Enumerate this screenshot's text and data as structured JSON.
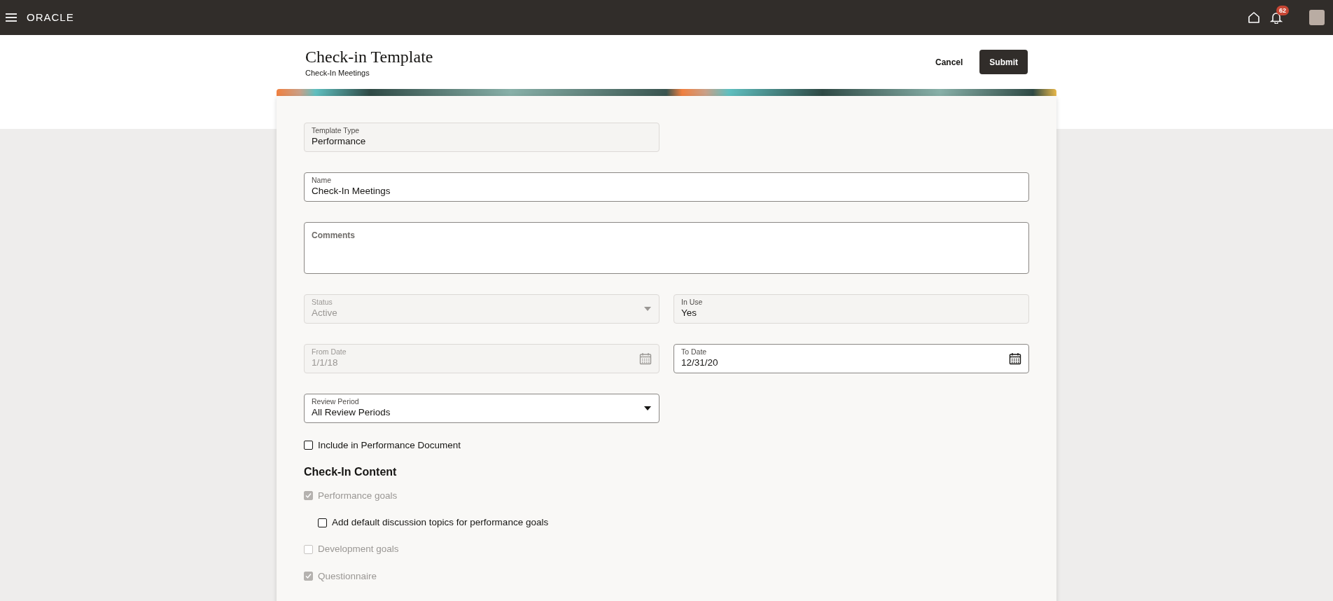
{
  "header": {
    "logo": "ORACLE",
    "notifications_count": "62"
  },
  "page": {
    "title": "Check-in Template",
    "subtitle": "Check-In Meetings",
    "actions": [
      {
        "label": "Cancel",
        "kind": "text"
      },
      {
        "label": "Submit",
        "kind": "primary"
      }
    ]
  },
  "form": {
    "rows": [
      [
        {
          "label": "Template Type",
          "value": "Performance",
          "kind": "readonly",
          "disabled": false
        }
      ],
      [
        {
          "label": "Name",
          "value": "Check-In Meetings",
          "kind": "text",
          "disabled": false,
          "wide": true
        }
      ],
      [
        {
          "label": "Comments",
          "kind": "textarea",
          "disabled": false,
          "wide": true
        }
      ],
      [
        {
          "label": "Status",
          "value": "Active",
          "kind": "select",
          "disabled": true
        },
        {
          "label": "In Use",
          "value": "Yes",
          "kind": "readonly",
          "disabled": false
        }
      ],
      [
        {
          "label": "From Date",
          "value": "1/1/18",
          "kind": "date",
          "disabled": true
        },
        {
          "label": "To Date",
          "value": "12/31/20",
          "kind": "date",
          "disabled": false
        }
      ],
      [
        {
          "label": "Review Period",
          "value": "All Review Periods",
          "kind": "select",
          "disabled": false
        }
      ]
    ],
    "include_checkbox": {
      "label": "Include in Performance Document",
      "checked": false,
      "disabled": false
    },
    "section_title": "Check-In Content",
    "content_items": [
      {
        "label": "Performance goals",
        "checked": true,
        "disabled": true,
        "children": [
          {
            "label": "Add default discussion topics for performance goals",
            "checked": false,
            "disabled": false
          }
        ]
      },
      {
        "label": "Development goals",
        "checked": false,
        "disabled": true
      },
      {
        "label": "Questionnaire",
        "checked": true,
        "disabled": true
      }
    ]
  }
}
